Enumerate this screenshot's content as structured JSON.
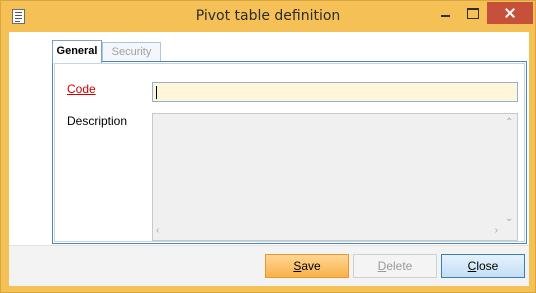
{
  "window": {
    "title": "Pivot table definition",
    "app_icon": "form-document-icon",
    "controls": [
      "minimize-icon",
      "maximize-icon",
      "close-icon"
    ]
  },
  "tabs": [
    {
      "label": "General",
      "active": true
    },
    {
      "label": "Security",
      "active": false
    }
  ],
  "form": {
    "code_label": "Code",
    "code_value": "",
    "description_label": "Description",
    "description_value": ""
  },
  "buttons": {
    "save": {
      "first": "S",
      "rest": "ave"
    },
    "delete": {
      "first": "D",
      "rest": "elete"
    },
    "close": {
      "first": "C",
      "rest": "lose"
    }
  },
  "scroll_arrows": {
    "up": "⌃",
    "down": "⌄",
    "left": "‹",
    "right": "›"
  },
  "colors": {
    "title_bar": "#f5c055",
    "close_button": "#c7503a",
    "required_label": "#d20000",
    "code_field_bg": "#fff6d9",
    "tab_border": "#4b86b9"
  }
}
